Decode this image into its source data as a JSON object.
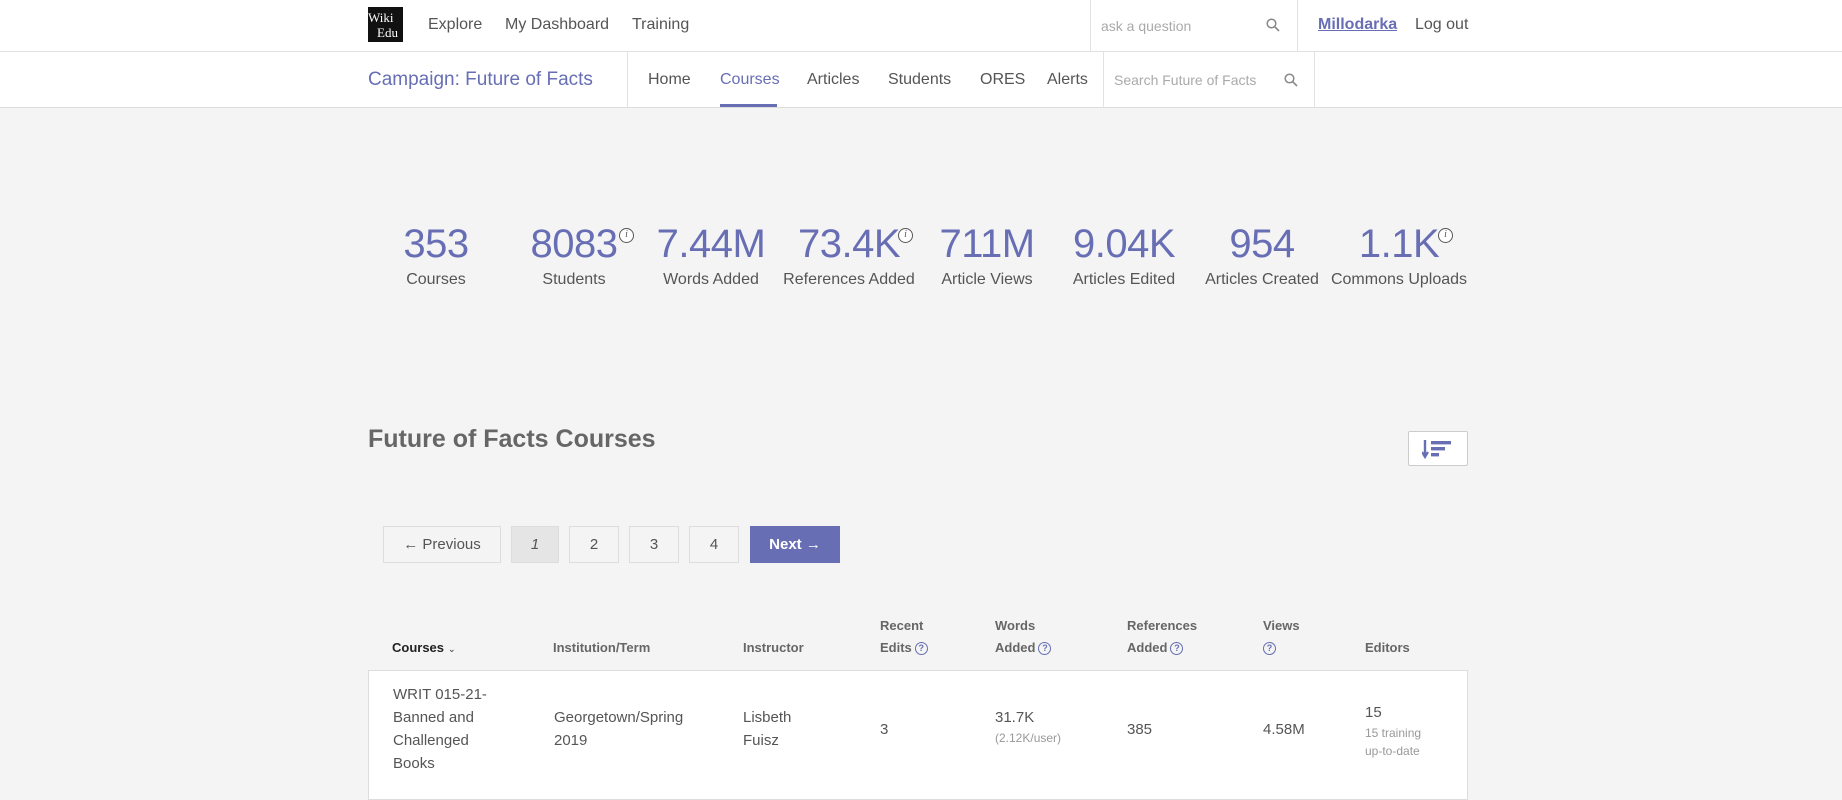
{
  "header": {
    "logo_line1": "Wiki",
    "logo_line2": "Edu",
    "nav": [
      "Explore",
      "My Dashboard",
      "Training"
    ],
    "search_placeholder": "ask a question",
    "username": "Millodarka",
    "logout": "Log out"
  },
  "campaign": {
    "title": "Campaign: Future of Facts",
    "tabs": [
      "Home",
      "Courses",
      "Articles",
      "Students",
      "ORES",
      "Alerts"
    ],
    "active_tab": "Courses",
    "search_placeholder": "Search Future of Facts"
  },
  "stats": [
    {
      "value": "353",
      "label": "Courses",
      "info": false
    },
    {
      "value": "8083",
      "label": "Students",
      "info": true
    },
    {
      "value": "7.44M",
      "label": "Words Added",
      "info": false
    },
    {
      "value": "73.4K",
      "label": "References Added",
      "info": true
    },
    {
      "value": "711M",
      "label": "Article Views",
      "info": false
    },
    {
      "value": "9.04K",
      "label": "Articles Edited",
      "info": false
    },
    {
      "value": "954",
      "label": "Articles Created",
      "info": false
    },
    {
      "value": "1.1K",
      "label": "Commons Uploads",
      "info": true
    }
  ],
  "courses_section": {
    "title": "Future of Facts Courses",
    "sort_icon": "sort-descending-icon"
  },
  "pagination": {
    "previous": "← Previous",
    "pages": [
      "1",
      "2",
      "3",
      "4"
    ],
    "current": "1",
    "next": "Next →"
  },
  "table": {
    "headers": {
      "courses": "Courses",
      "institution": "Institution/Term",
      "instructor": "Instructor",
      "recent_edits_1": "Recent",
      "recent_edits_2": "Edits",
      "words_added_1": "Words",
      "words_added_2": "Added",
      "references_added_1": "References",
      "references_added_2": "Added",
      "views": "Views",
      "editors": "Editors"
    },
    "rows": [
      {
        "course_lines": [
          "WRIT 015-21-",
          "Banned and",
          "Challenged",
          "Books"
        ],
        "institution_lines": [
          "Georgetown/Spring",
          "2019"
        ],
        "instructor_lines": [
          "Lisbeth",
          "Fuisz"
        ],
        "recent_edits": "3",
        "words_added": "31.7K",
        "words_per_user": "(2.12K/user)",
        "references_added": "385",
        "views": "4.58M",
        "editors": "15",
        "editors_training_lines": [
          "15 training",
          "up-to-date"
        ]
      }
    ]
  },
  "colors": {
    "accent": "#676eb4",
    "background": "#f4f4f4"
  }
}
